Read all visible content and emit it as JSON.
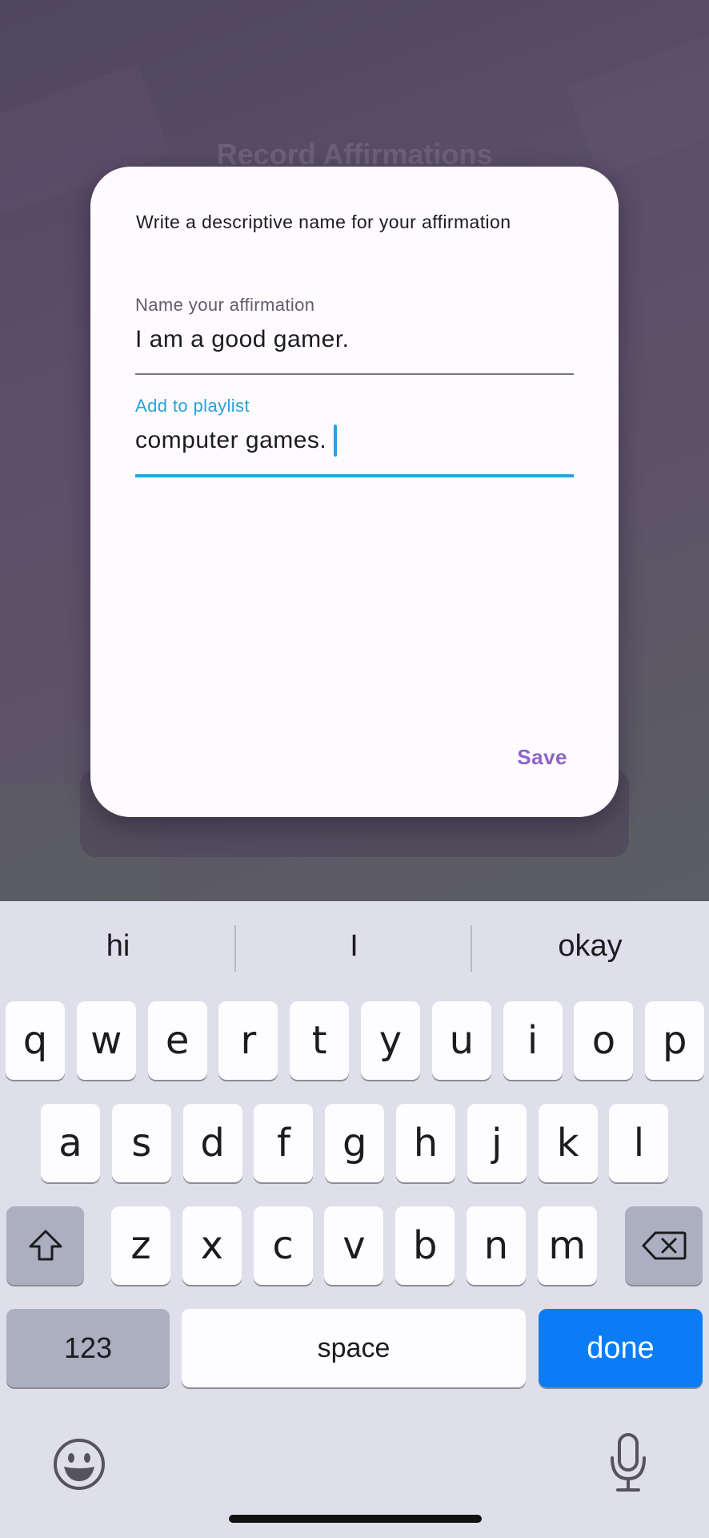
{
  "background": {
    "title": "Record Affirmations"
  },
  "dialog": {
    "heading": "Write a descriptive name for your affirmation",
    "name_field": {
      "label": "Name your affirmation",
      "value": "I am a good gamer."
    },
    "playlist_field": {
      "label": "Add to playlist",
      "value": "computer games."
    },
    "save_label": "Save"
  },
  "keyboard": {
    "suggestions": [
      "hi",
      "I",
      "okay"
    ],
    "row1": [
      "q",
      "w",
      "e",
      "r",
      "t",
      "y",
      "u",
      "i",
      "o",
      "p"
    ],
    "row2": [
      "a",
      "s",
      "d",
      "f",
      "g",
      "h",
      "j",
      "k",
      "l"
    ],
    "row3": [
      "z",
      "x",
      "c",
      "v",
      "b",
      "n",
      "m"
    ],
    "numbers_label": "123",
    "space_label": "space",
    "done_label": "done",
    "icons": [
      "shift-icon",
      "backspace-icon",
      "emoji-icon",
      "microphone-icon"
    ]
  },
  "colors": {
    "accent_focus": "#2aa0e6",
    "save_text": "#8e63c9",
    "done_key": "#0a7df6"
  }
}
